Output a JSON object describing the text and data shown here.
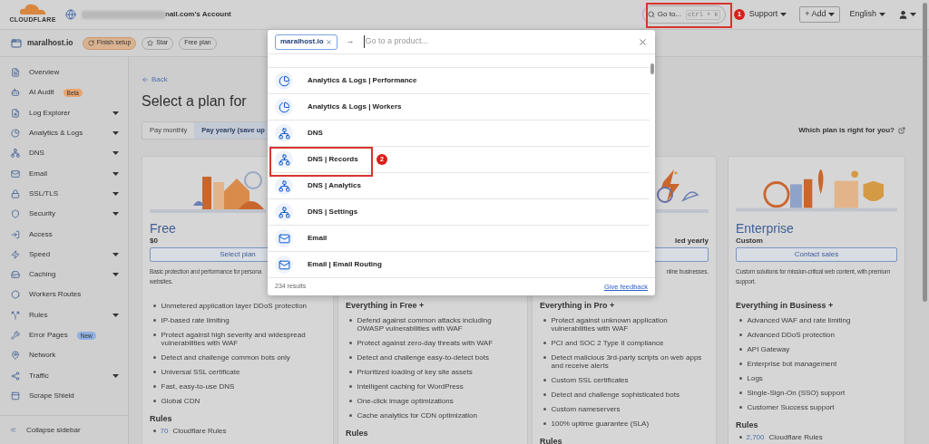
{
  "top_bar": {
    "brand": "CLOUDFLARE",
    "account": "nail.com's Account",
    "goto": {
      "label": "Go to...",
      "shortcut": "ctrl + k"
    },
    "menus": [
      {
        "label": "Support",
        "kind": "menu"
      },
      {
        "label": "+ Add",
        "kind": "button"
      },
      {
        "label": "English",
        "kind": "menu"
      }
    ]
  },
  "sub_bar": {
    "domain": "maralhost.io",
    "chips": [
      {
        "label": "Finish setup",
        "kind": "setup"
      },
      {
        "label": "Star",
        "kind": "star"
      },
      {
        "label": "Free plan",
        "kind": "plain"
      }
    ]
  },
  "sidebar": {
    "items": [
      {
        "label": "Overview",
        "expandable": false
      },
      {
        "label": "AI Audit",
        "expandable": false,
        "badge": {
          "text": "Beta",
          "color": "#e8a36e"
        }
      },
      {
        "label": "Log Explorer",
        "expandable": true
      },
      {
        "label": "Analytics & Logs",
        "expandable": true
      },
      {
        "label": "DNS",
        "expandable": true
      },
      {
        "label": "Email",
        "expandable": true
      },
      {
        "label": "SSL/TLS",
        "expandable": true
      },
      {
        "label": "Security",
        "expandable": true
      },
      {
        "label": "Access",
        "expandable": false
      },
      {
        "label": "Speed",
        "expandable": true
      },
      {
        "label": "Caching",
        "expandable": true
      },
      {
        "label": "Workers Routes",
        "expandable": false
      },
      {
        "label": "Rules",
        "expandable": true
      },
      {
        "label": "Error Pages",
        "expandable": false,
        "badge": {
          "text": "New",
          "color": "#8fb1e3"
        }
      },
      {
        "label": "Network",
        "expandable": false
      },
      {
        "label": "Traffic",
        "expandable": true
      },
      {
        "label": "Scrape Shield",
        "expandable": false
      }
    ],
    "collapse": "Collapse sidebar"
  },
  "content": {
    "back": "Back",
    "heading": "Select a plan for",
    "billing_tabs": [
      {
        "label": "Pay monthly",
        "selected": false
      },
      {
        "label": "Pay yearly (save up",
        "selected": true
      }
    ],
    "help_link": "Which plan is right for you?",
    "plans": [
      {
        "illustration": true,
        "name": "Free",
        "price": "$0",
        "button": "Select plan",
        "description": [
          "Basic protection and performance for persona",
          "websites."
        ],
        "features": [
          "Unmetered application layer DDoS protection",
          "IP-based rate limiting",
          "Protect against high severity and widespread vulnerabilities with WAF",
          "Detect and challenge common bots only",
          "Universal SSL certificate",
          "Fast, easy-to-use DNS",
          "Global CDN"
        ],
        "rules_heading": "Rules",
        "rules": [
          {
            "count": "70",
            "label": "Cloudflare Rules"
          }
        ]
      },
      {
        "features_heading": "Everything in Free +",
        "features": [
          "Defend against common attacks including OWASP vulnerabilities with WAF",
          "Protect against zero-day threats with WAF",
          "Detect and challenge easy-to-detect bots",
          "Prioritized loading of key site assets",
          "Intelligent caching for WordPress",
          "One-click image optimizations",
          "Cache analytics for CDN optimization"
        ],
        "rules_heading": "Rules"
      },
      {
        "illustration": true,
        "price": "led yearly",
        "blank_button": true,
        "description": [
          "nline businesses."
        ],
        "features_heading": "Everything in Pro +",
        "features": [
          "Protect against unknown application vulnerabilities with WAF",
          "PCI and SOC 2 Type II compliance",
          "Detect malicious 3rd-party scripts on web apps and receive alerts",
          "Custom SSL certificates",
          "Detect and challenge sophisticated bots",
          "Custom nameservers",
          "100% uptime guarantee (SLA)"
        ],
        "rules_heading": "Rules"
      },
      {
        "illustration": true,
        "name": "Enterprise",
        "price": "Custom",
        "button": "Contact sales",
        "description": [
          "Custom solutions for mission-critical web content, with premium support."
        ],
        "features_heading": "Everything in Business +",
        "features": [
          "Advanced WAF and rate limiting",
          "Advanced DDoS protection",
          "API Gateway",
          "Enterprise bot management",
          "Logs",
          "Single-Sign-On (SSO) support",
          "Customer Success support"
        ],
        "rules_heading": "Rules",
        "rules": [
          {
            "count": "2,700",
            "label": "Cloudflare Rules"
          }
        ]
      }
    ]
  },
  "palette": {
    "chip": "maralhost.io",
    "arrow": "→",
    "placeholder": "Go to a product...",
    "results": [
      {
        "label": "Analytics & Logs | Performance",
        "kind": "analytics"
      },
      {
        "label": "Analytics & Logs | Workers",
        "kind": "analytics"
      },
      {
        "label": "DNS",
        "kind": "dns"
      },
      {
        "label": "DNS | Records",
        "kind": "dns"
      },
      {
        "label": "DNS | Analytics",
        "kind": "dns"
      },
      {
        "label": "DNS | Settings",
        "kind": "dns"
      },
      {
        "label": "Email",
        "kind": "email"
      },
      {
        "label": "Email | Email Routing",
        "kind": "email"
      }
    ],
    "count": "234 results",
    "feedback": "Give feedback"
  },
  "annotations": [
    {
      "number": "1"
    },
    {
      "number": "2"
    }
  ]
}
